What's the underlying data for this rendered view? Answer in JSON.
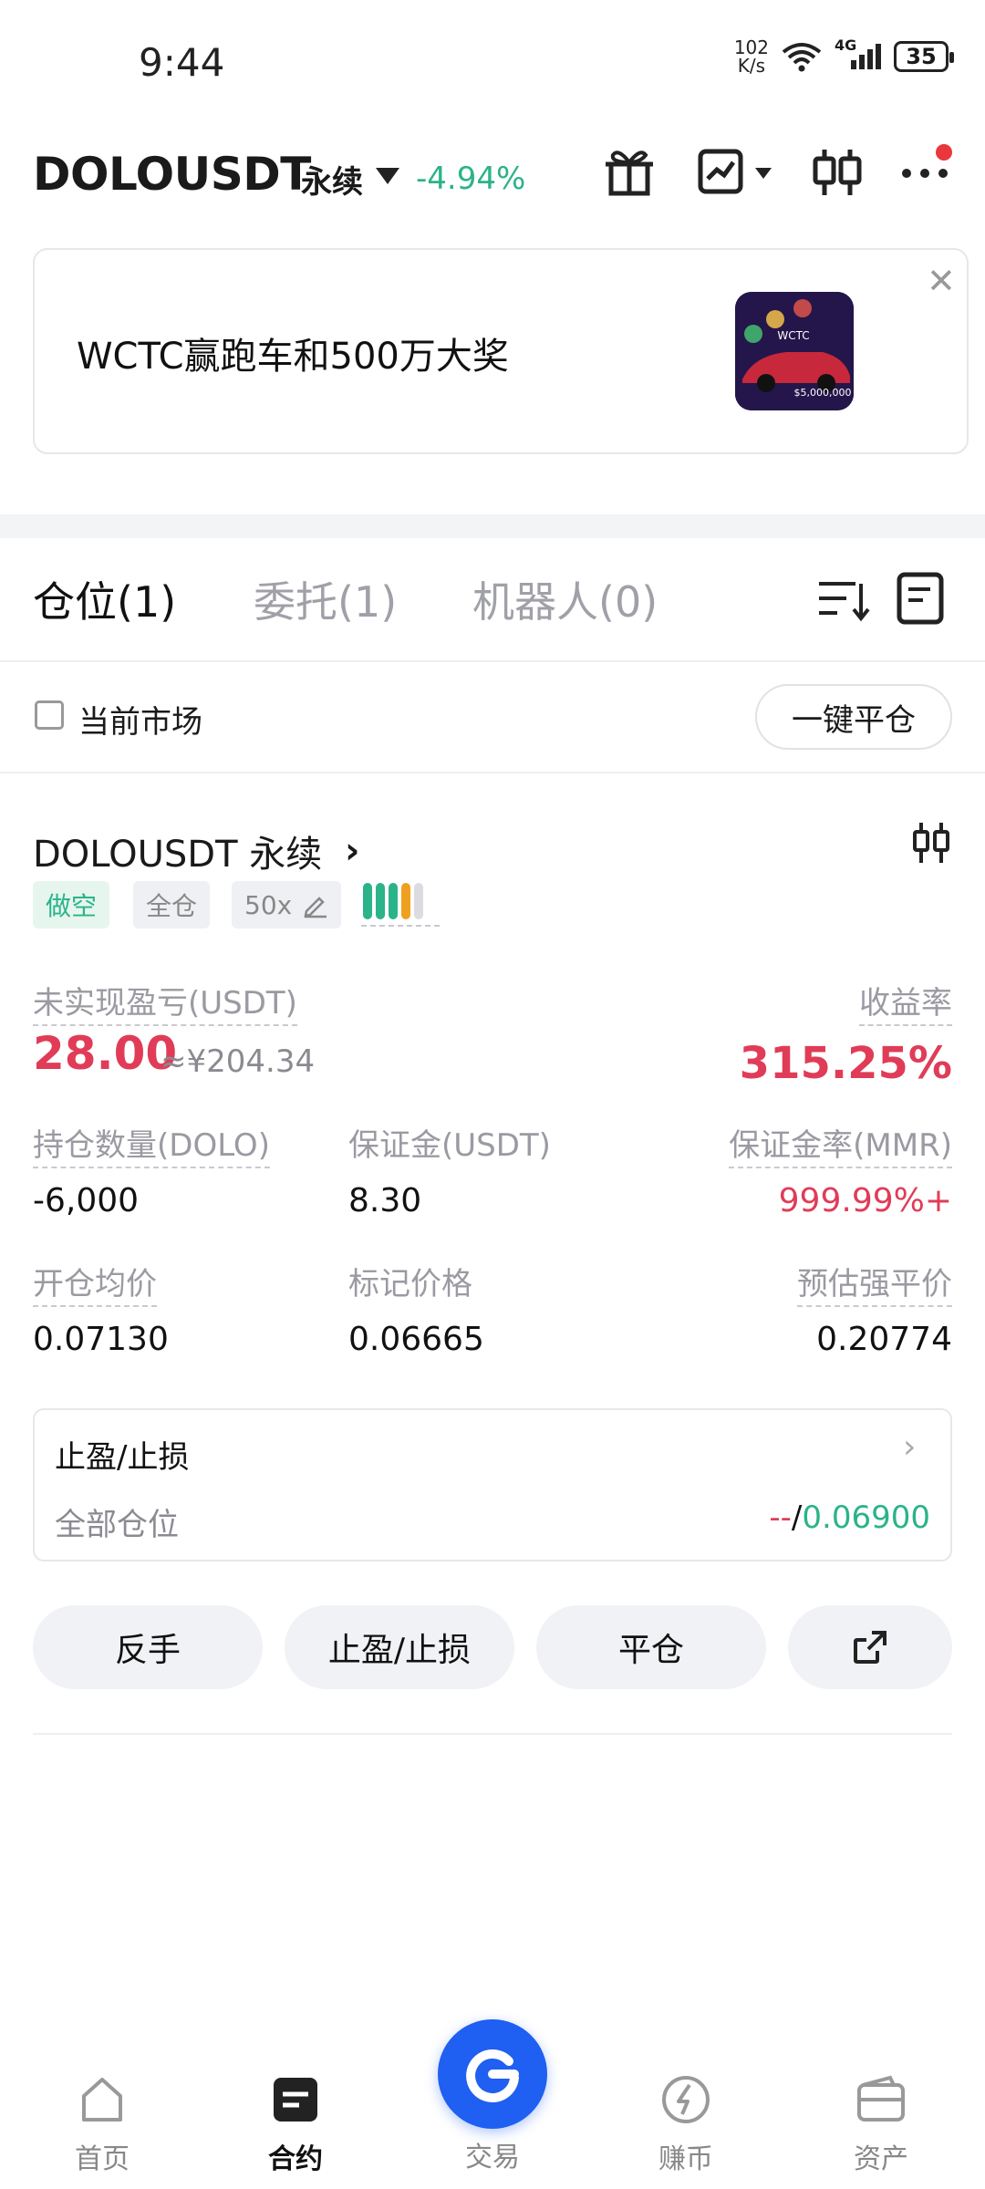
{
  "status_bar": {
    "time": "9:44",
    "net_speed_value": "102",
    "net_speed_unit": "K/s",
    "network_type": "4G",
    "battery": "35"
  },
  "header": {
    "symbol": "DOLOUSDT",
    "contract_type": "永续",
    "change": "-4.94%",
    "icons": [
      "gift-icon",
      "chart-trend-icon",
      "candlestick-icon",
      "more-icon"
    ]
  },
  "banner": {
    "text": "WCTC赢跑车和500万大奖",
    "image_caption": "$5,000,000"
  },
  "tabs": [
    {
      "label": "仓位(1)",
      "active": true
    },
    {
      "label": "委托(1)",
      "active": false
    },
    {
      "label": "机器人(0)",
      "active": false
    }
  ],
  "filter": {
    "current_market_label": "当前市场",
    "close_all_label": "一键平仓"
  },
  "position": {
    "title": "DOLOUSDT 永续",
    "side_tag": "做空",
    "margin_mode_tag": "全仓",
    "leverage_tag": "50x",
    "leverage_bar_colors": [
      "#2bb389",
      "#2bb389",
      "#2bb389",
      "#f0a020",
      "#dcdce0"
    ],
    "unrealized_pnl_label": "未实现盈亏(USDT)",
    "unrealized_pnl_value": "28.00",
    "unrealized_pnl_cny": "≈¥204.34",
    "roe_label": "收益率",
    "roe_value": "315.25%",
    "size_label": "持仓数量(DOLO)",
    "size_value": "-6,000",
    "margin_label": "保证金(USDT)",
    "margin_value": "8.30",
    "mmr_label": "保证金率(MMR)",
    "mmr_value": "999.99%+",
    "entry_price_label": "开仓均价",
    "entry_price_value": "0.07130",
    "mark_price_label": "标记价格",
    "mark_price_value": "0.06665",
    "liq_price_label": "预估强平价",
    "liq_price_value": "0.20774"
  },
  "tpsl": {
    "title": "止盈/止损",
    "scope": "全部仓位",
    "tp_value": "--",
    "divider": "/",
    "sl_value": "0.06900"
  },
  "actions": {
    "reverse": "反手",
    "tpsl": "止盈/止损",
    "close": "平仓"
  },
  "bottom_nav": [
    {
      "label": "首页",
      "icon": "home-icon",
      "active": false
    },
    {
      "label": "合约",
      "icon": "futures-icon",
      "active": true
    },
    {
      "label": "交易",
      "icon": "trade-icon",
      "active": false
    },
    {
      "label": "赚币",
      "icon": "earn-icon",
      "active": false
    },
    {
      "label": "资产",
      "icon": "wallet-icon",
      "active": false
    }
  ]
}
